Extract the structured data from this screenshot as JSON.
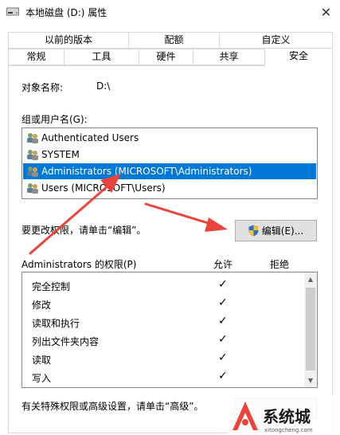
{
  "window": {
    "title": "本地磁盘 (D:) 属性",
    "close_symbol": "✕"
  },
  "tabs_top": [
    "以前的版本",
    "配额",
    "自定义"
  ],
  "tabs_bottom": [
    "常规",
    "工具",
    "硬件",
    "共享",
    "安全"
  ],
  "active_tab": "安全",
  "object_name": {
    "label": "对象名称:",
    "value": "D:\\"
  },
  "group_label": "组或用户名(G):",
  "users": [
    {
      "name": "Authenticated Users",
      "selected": false
    },
    {
      "name": "SYSTEM",
      "selected": false
    },
    {
      "name": "Administrators (MICROSOFT\\Administrators)",
      "selected": true
    },
    {
      "name": "Users (MICROSOFT\\Users)",
      "selected": false
    }
  ],
  "change_perm_hint": "要更改权限，请单击“编辑”。",
  "edit_button": "编辑(E)...",
  "permissions_header": {
    "title": "Administrators 的权限(P)",
    "allow": "允许",
    "deny": "拒绝"
  },
  "permissions": [
    {
      "name": "完全控制",
      "allow": "✓"
    },
    {
      "name": "修改",
      "allow": "✓"
    },
    {
      "name": "读取和执行",
      "allow": "✓"
    },
    {
      "name": "列出文件夹内容",
      "allow": "✓"
    },
    {
      "name": "读取",
      "allow": "✓"
    },
    {
      "name": "写入",
      "allow": "✓"
    }
  ],
  "advanced_hint": "有关特殊权限或高级设置，请单击“高级”。",
  "watermark": "系统城 xitongcheng.com",
  "colors": {
    "selection": "#0078d7",
    "arrow": "#e8453c",
    "panel_border": "#d9d9d9"
  }
}
